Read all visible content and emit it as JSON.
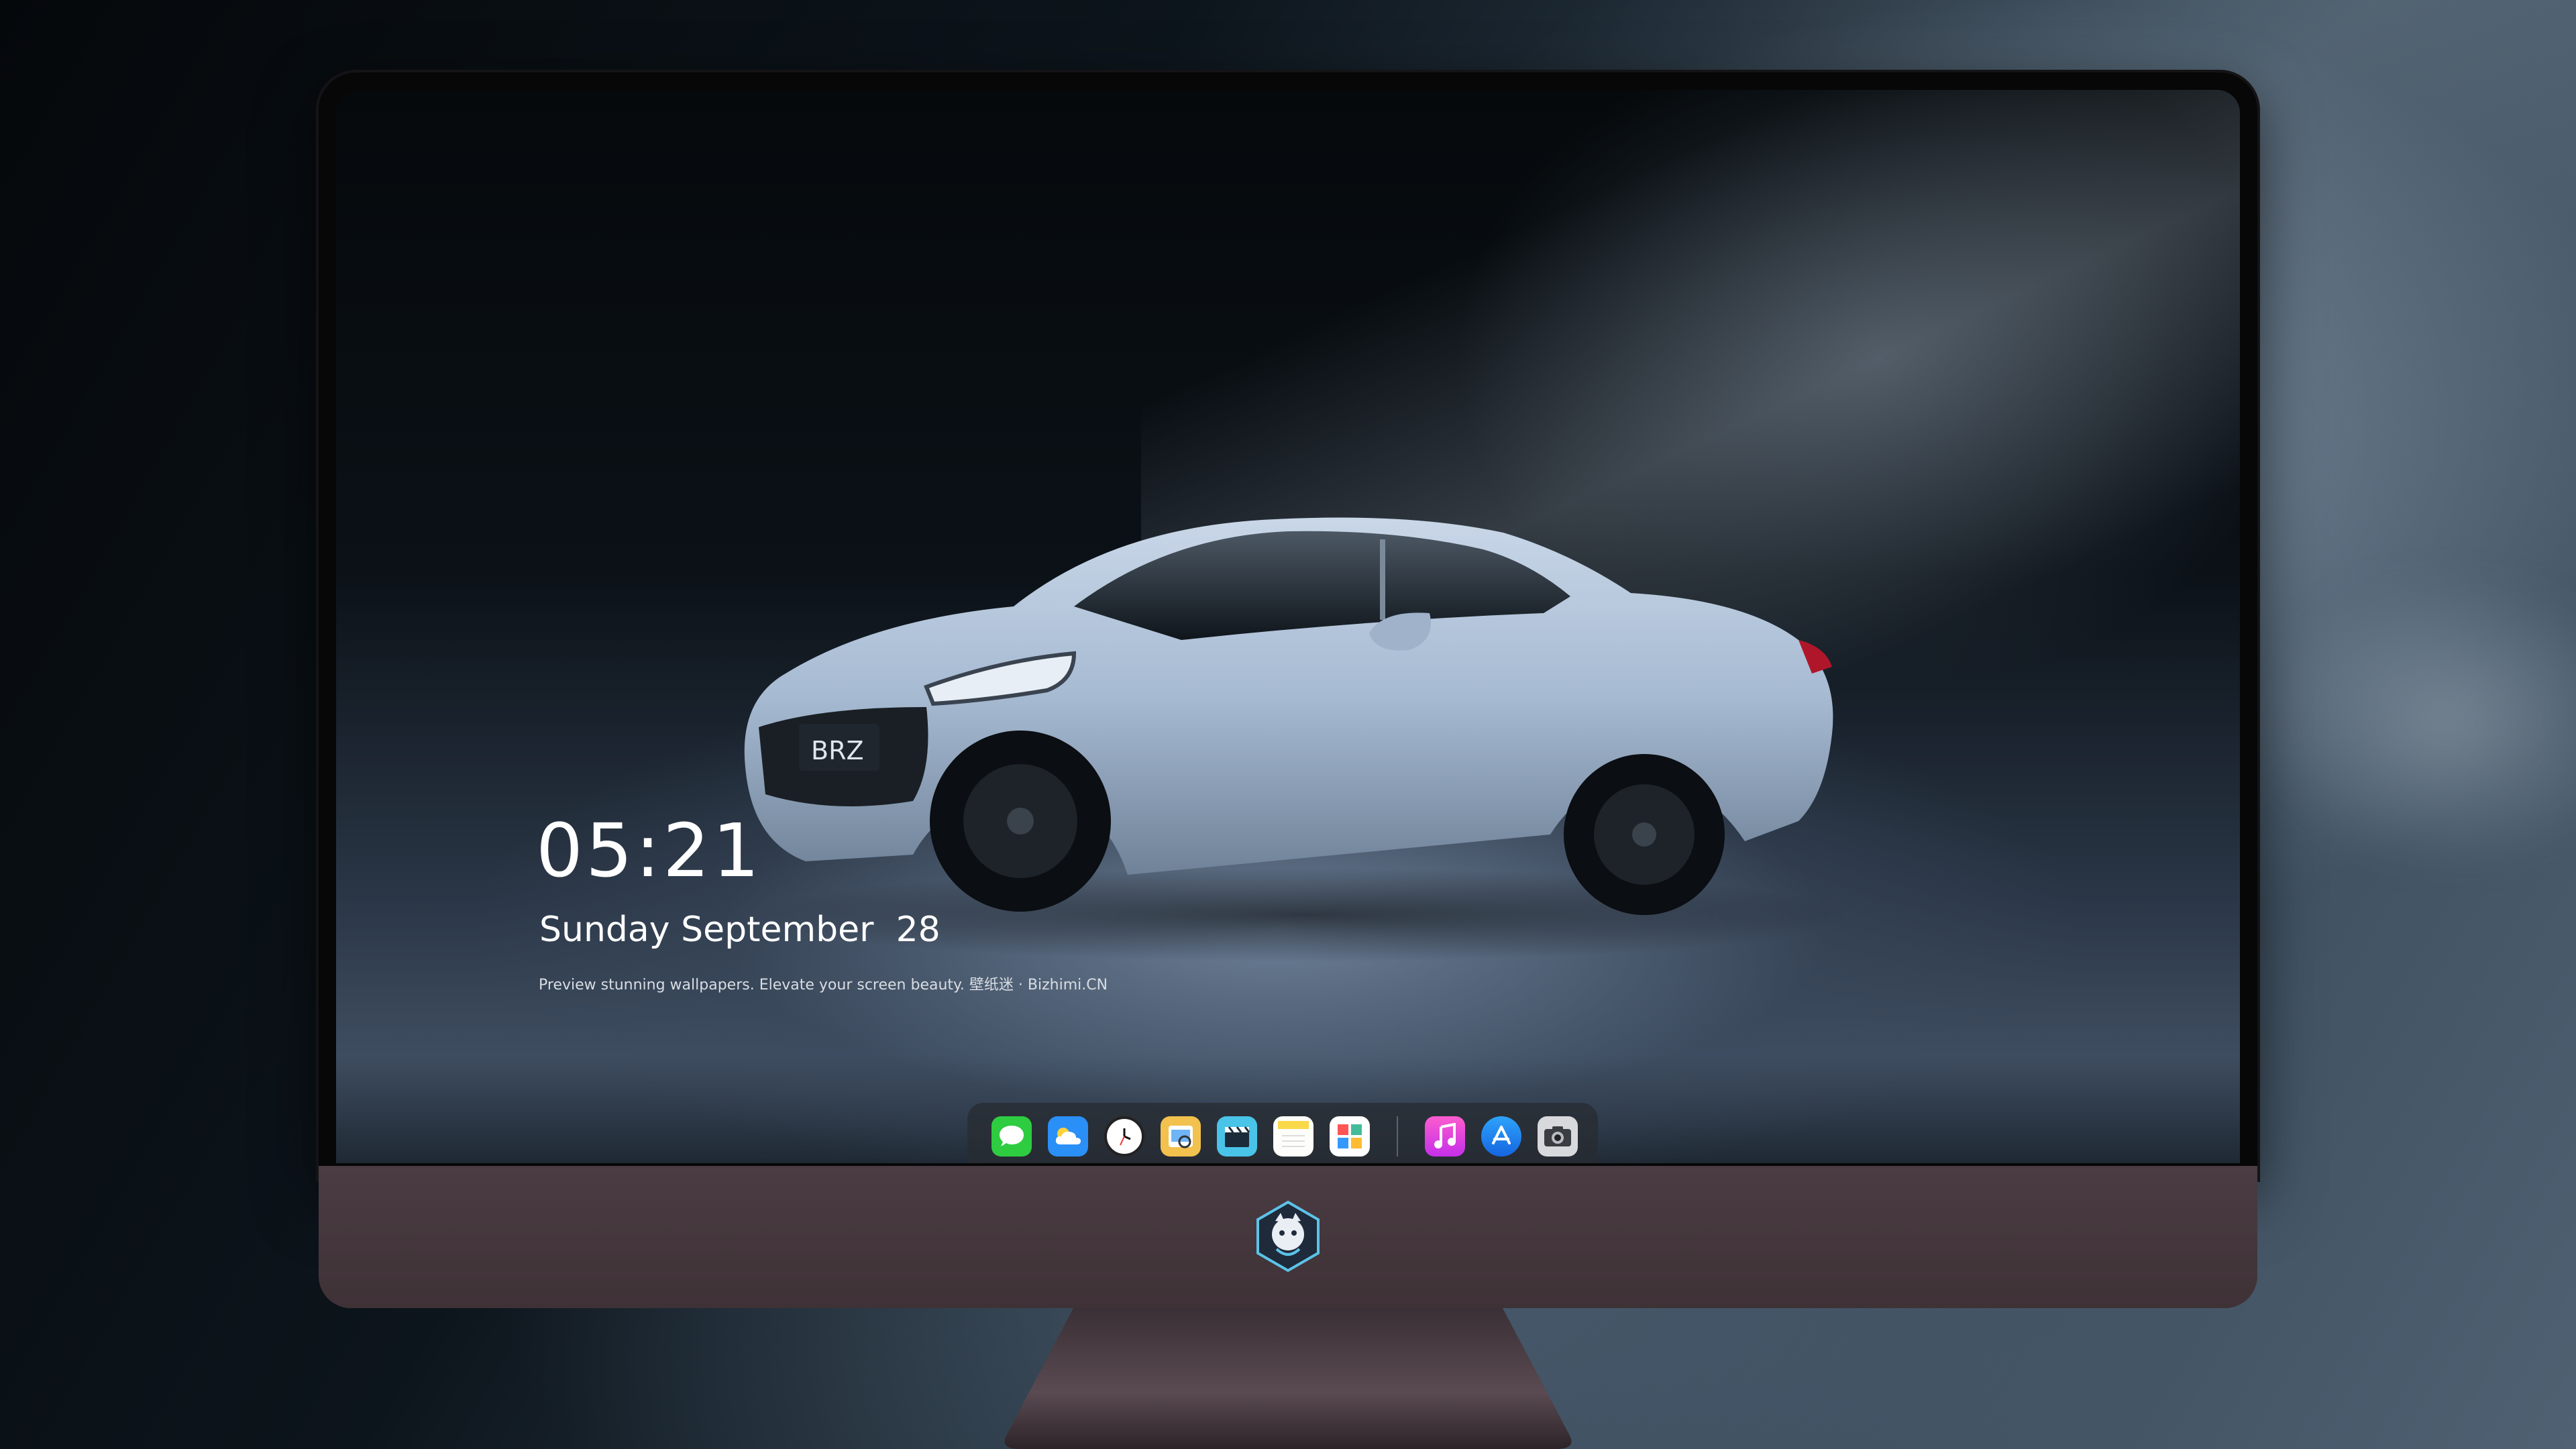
{
  "clock": {
    "time": "05:21"
  },
  "date": {
    "text": "Sunday September  28"
  },
  "tagline": {
    "text": "Preview stunning wallpapers. Elevate your screen beauty. 壁纸迷 · Bizhimi.CN"
  },
  "car": {
    "badge": "BRZ",
    "body_color": "#a9bed6"
  },
  "dock": {
    "icons": [
      {
        "name": "messages-icon",
        "color": "#2ecc40"
      },
      {
        "name": "weather-icon",
        "color": "#2a8ff7"
      },
      {
        "name": "clock-icon",
        "color": "#ffffff"
      },
      {
        "name": "preview-icon",
        "color": "#f2c14e"
      },
      {
        "name": "final-cut-icon",
        "color": "#4ac3e8"
      },
      {
        "name": "notes-icon",
        "color": "#f9d949"
      },
      {
        "name": "photos-app-icon",
        "color": "#ffffff"
      },
      {
        "name": "music-icon",
        "color": "#e93fd0"
      },
      {
        "name": "app-store-icon",
        "color": "#1e8ef5"
      },
      {
        "name": "camera-icon",
        "color": "#8a8d92"
      }
    ]
  },
  "colors": {
    "chin": "#4a3c42",
    "bezel": "#070708"
  }
}
